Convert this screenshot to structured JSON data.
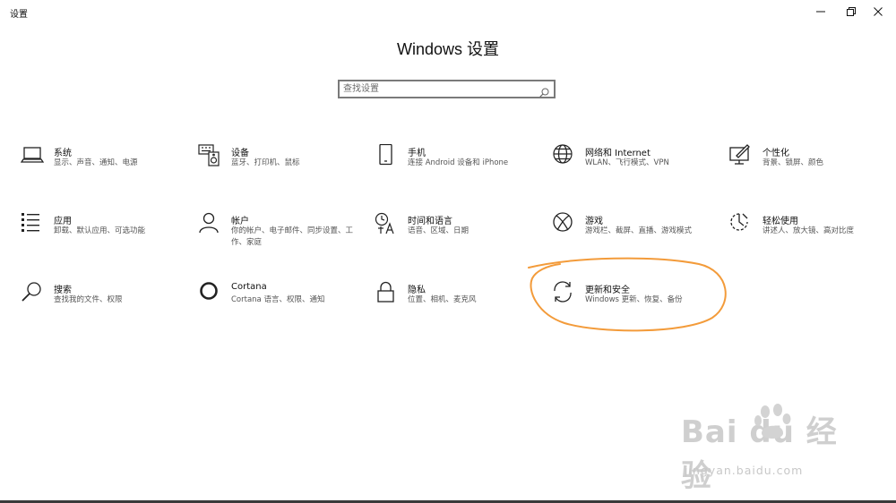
{
  "window": {
    "title": "设置",
    "controls": {
      "minimize": "minimize",
      "maximize": "maximize",
      "close": "close"
    }
  },
  "header": {
    "title": "Windows 设置"
  },
  "search": {
    "placeholder": "查找设置",
    "value": ""
  },
  "tiles": [
    {
      "icon": "laptop-icon",
      "title": "系统",
      "desc": "显示、声音、通知、电源"
    },
    {
      "icon": "keyboard-speaker-icon",
      "title": "设备",
      "desc": "蓝牙、打印机、鼠标"
    },
    {
      "icon": "phone-icon",
      "title": "手机",
      "desc": "连接 Android 设备和 iPhone"
    },
    {
      "icon": "globe-icon",
      "title": "网络和 Internet",
      "desc": "WLAN、飞行模式、VPN"
    },
    {
      "icon": "personalization-icon",
      "title": "个性化",
      "desc": "背景、锁屏、颜色"
    },
    {
      "icon": "apps-list-icon",
      "title": "应用",
      "desc": "卸载、默认应用、可选功能"
    },
    {
      "icon": "person-icon",
      "title": "帐户",
      "desc": "你的帐户、电子邮件、同步设置、工作、家庭"
    },
    {
      "icon": "time-language-icon",
      "title": "时间和语言",
      "desc": "语音、区域、日期"
    },
    {
      "icon": "xbox-icon",
      "title": "游戏",
      "desc": "游戏栏、截屏、直播、游戏模式"
    },
    {
      "icon": "ease-of-access-icon",
      "title": "轻松使用",
      "desc": "讲述人、放大镜、高对比度"
    },
    {
      "icon": "search-magnifier-icon",
      "title": "搜索",
      "desc": "查找我的文件、权限"
    },
    {
      "icon": "cortana-ring-icon",
      "title": "Cortana",
      "desc": "Cortana 语言、权限、通知"
    },
    {
      "icon": "lock-icon",
      "title": "隐私",
      "desc": "位置、相机、麦克风"
    },
    {
      "icon": "sync-arrows-icon",
      "title": "更新和安全",
      "desc": "Windows 更新、恢复、备份"
    }
  ],
  "annotation": {
    "color": "#f39b3a"
  },
  "watermark": {
    "brand": "Bai du 经验",
    "url": "jingyan.baidu.com"
  }
}
